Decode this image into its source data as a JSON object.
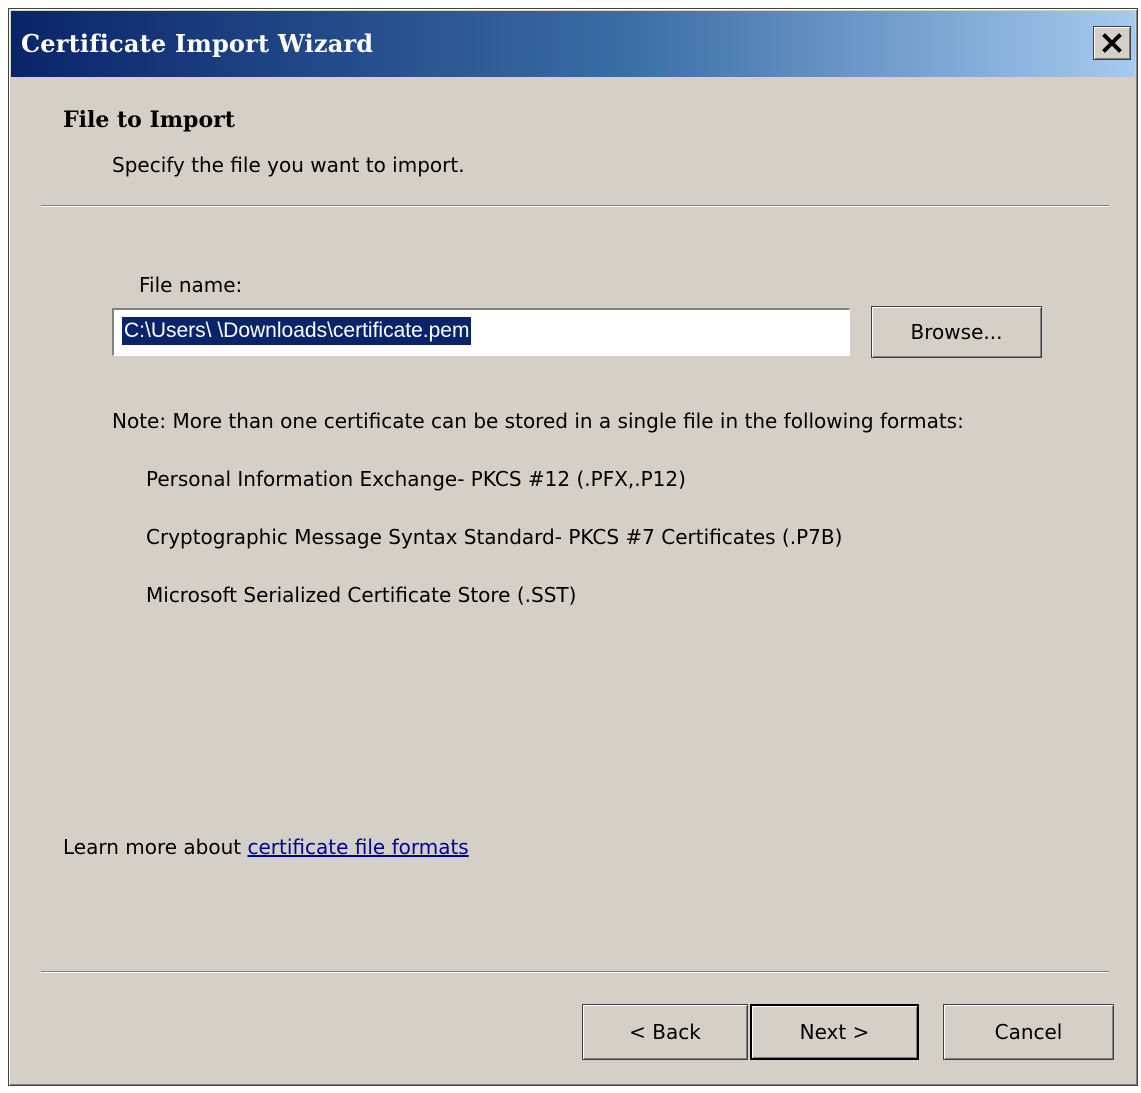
{
  "window": {
    "title": "Certificate Import Wizard",
    "close_label": "X"
  },
  "page": {
    "heading": "File to Import",
    "subheading": "Specify the file you want to import."
  },
  "file": {
    "label": "File name:",
    "value": "C:\\Users\\        \\Downloads\\certificate.pem",
    "browse_label": "Browse..."
  },
  "note": {
    "text": "Note:  More than one certificate can be stored in a single file in the following formats:",
    "formats": [
      "Personal Information Exchange- PKCS #12 (.PFX,.P12)",
      "Cryptographic Message Syntax Standard- PKCS #7 Certificates (.P7B)",
      "Microsoft Serialized Certificate Store (.SST)"
    ]
  },
  "learn_more": {
    "prefix": "Learn more about ",
    "link": "certificate file formats"
  },
  "buttons": {
    "back": "< Back",
    "next": "Next >",
    "cancel": "Cancel"
  },
  "colors": {
    "titlebar_start": "#0a246a",
    "titlebar_end": "#a6caf0",
    "face": "#d4d0c8",
    "selection": "#0a246a",
    "link": "#00009c"
  }
}
